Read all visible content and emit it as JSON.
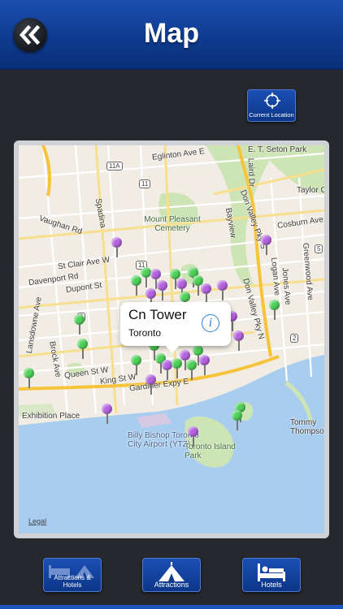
{
  "header": {
    "title": "Map",
    "back_icon": "double-chevron-left-icon"
  },
  "toolbar": {
    "current_location_label": "Current Location",
    "current_location_icon": "crosshair-icon"
  },
  "map": {
    "labels": {
      "eglinton": "Eglinton Ave E",
      "seton": "E. T. Seton Park",
      "taylor": "Taylor Cr",
      "vaughan": "Vaughan Rd",
      "stclair": "St Clair Ave W",
      "davenport": "Davenport Rd",
      "dupont": "Dupont St",
      "cemetery": "Mount Pleasant Cemetery",
      "cosburn": "Cosburn Ave",
      "queen": "Queen St W",
      "king": "King St W",
      "gardiner": "Gardiner Expy E",
      "exhibition": "Exhibition Place",
      "airport": "Billy Bishop Toronto City Airport (YTZ)",
      "island": "Toronto Island Park",
      "tommy": "Tommy Thompson",
      "spadina": "Spadina",
      "laird": "Laird Dr",
      "bayview": "Bayview",
      "don_valley": "Don Valley Pky S",
      "don_valley_n": "Don Valley Pky N",
      "greenwood": "Greenwood Ave",
      "logan": "Logan Ave",
      "jones": "Jones Ave",
      "lansdowne": "Lansdowne Ave",
      "brock": "Brock Ave",
      "shield_11a": "11A",
      "shield_11": "11",
      "shield_11b": "11",
      "shield_5": "5",
      "shield_5b": "5",
      "shield_2": "2",
      "shield_2b": "2"
    },
    "callout": {
      "title": "Cn Tower",
      "subtitle": "Toronto",
      "info_icon": "info-icon"
    },
    "legal": "Legal"
  },
  "tabs": [
    {
      "label": "Attractions & Hotels",
      "icon": "attractions-hotels-icon"
    },
    {
      "label": "Attractions",
      "icon": "tent-icon"
    },
    {
      "label": "Hotels",
      "icon": "bed-icon"
    }
  ],
  "colors": {
    "header_blue": "#0f3b90",
    "pin_purple": "#b564e0",
    "pin_green": "#4fd15a",
    "background": "#26282d"
  }
}
